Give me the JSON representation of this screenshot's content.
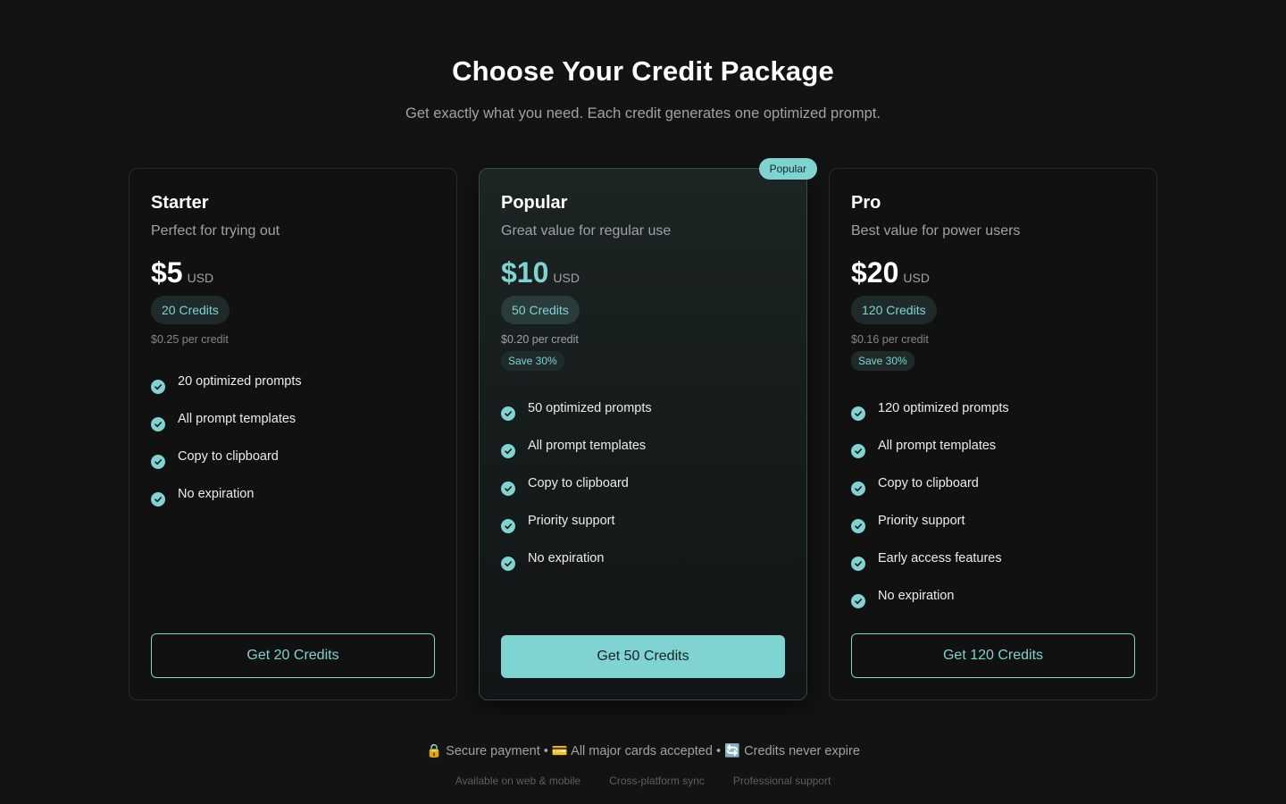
{
  "header": {
    "title": "Choose Your Credit Package",
    "subtitle": "Get exactly what you need. Each credit generates one optimized prompt."
  },
  "colors": {
    "accent": "#7fd3d1",
    "background": "#121212",
    "card": "#111111"
  },
  "plans": [
    {
      "name": "Starter",
      "description": "Perfect for trying out",
      "price": "$5",
      "currency": "USD",
      "credits": "20 Credits",
      "per_credit": "$0.25 per credit",
      "features": [
        "20 optimized prompts",
        "All prompt templates",
        "Copy to clipboard",
        "No expiration"
      ],
      "cta": "Get 20 Credits"
    },
    {
      "badge": "Popular",
      "name": "Popular",
      "description": "Great value for regular use",
      "price": "$10",
      "currency": "USD",
      "credits": "50 Credits",
      "per_credit": "$0.20 per credit",
      "save": "Save 30%",
      "features": [
        "50 optimized prompts",
        "All prompt templates",
        "Copy to clipboard",
        "Priority support",
        "No expiration"
      ],
      "cta": "Get 50 Credits"
    },
    {
      "name": "Pro",
      "description": "Best value for power users",
      "price": "$20",
      "currency": "USD",
      "credits": "120 Credits",
      "per_credit": "$0.16 per credit",
      "save": "Save 30%",
      "features": [
        "120 optimized prompts",
        "All prompt templates",
        "Copy to clipboard",
        "Priority support",
        "Early access features",
        "No expiration"
      ],
      "cta": "Get 120 Credits"
    }
  ],
  "footer": {
    "main": "🔒 Secure payment • 💳 All major cards accepted • 🔄 Credits never expire",
    "items": [
      "Available on web & mobile",
      "Cross-platform sync",
      "Professional support"
    ]
  }
}
